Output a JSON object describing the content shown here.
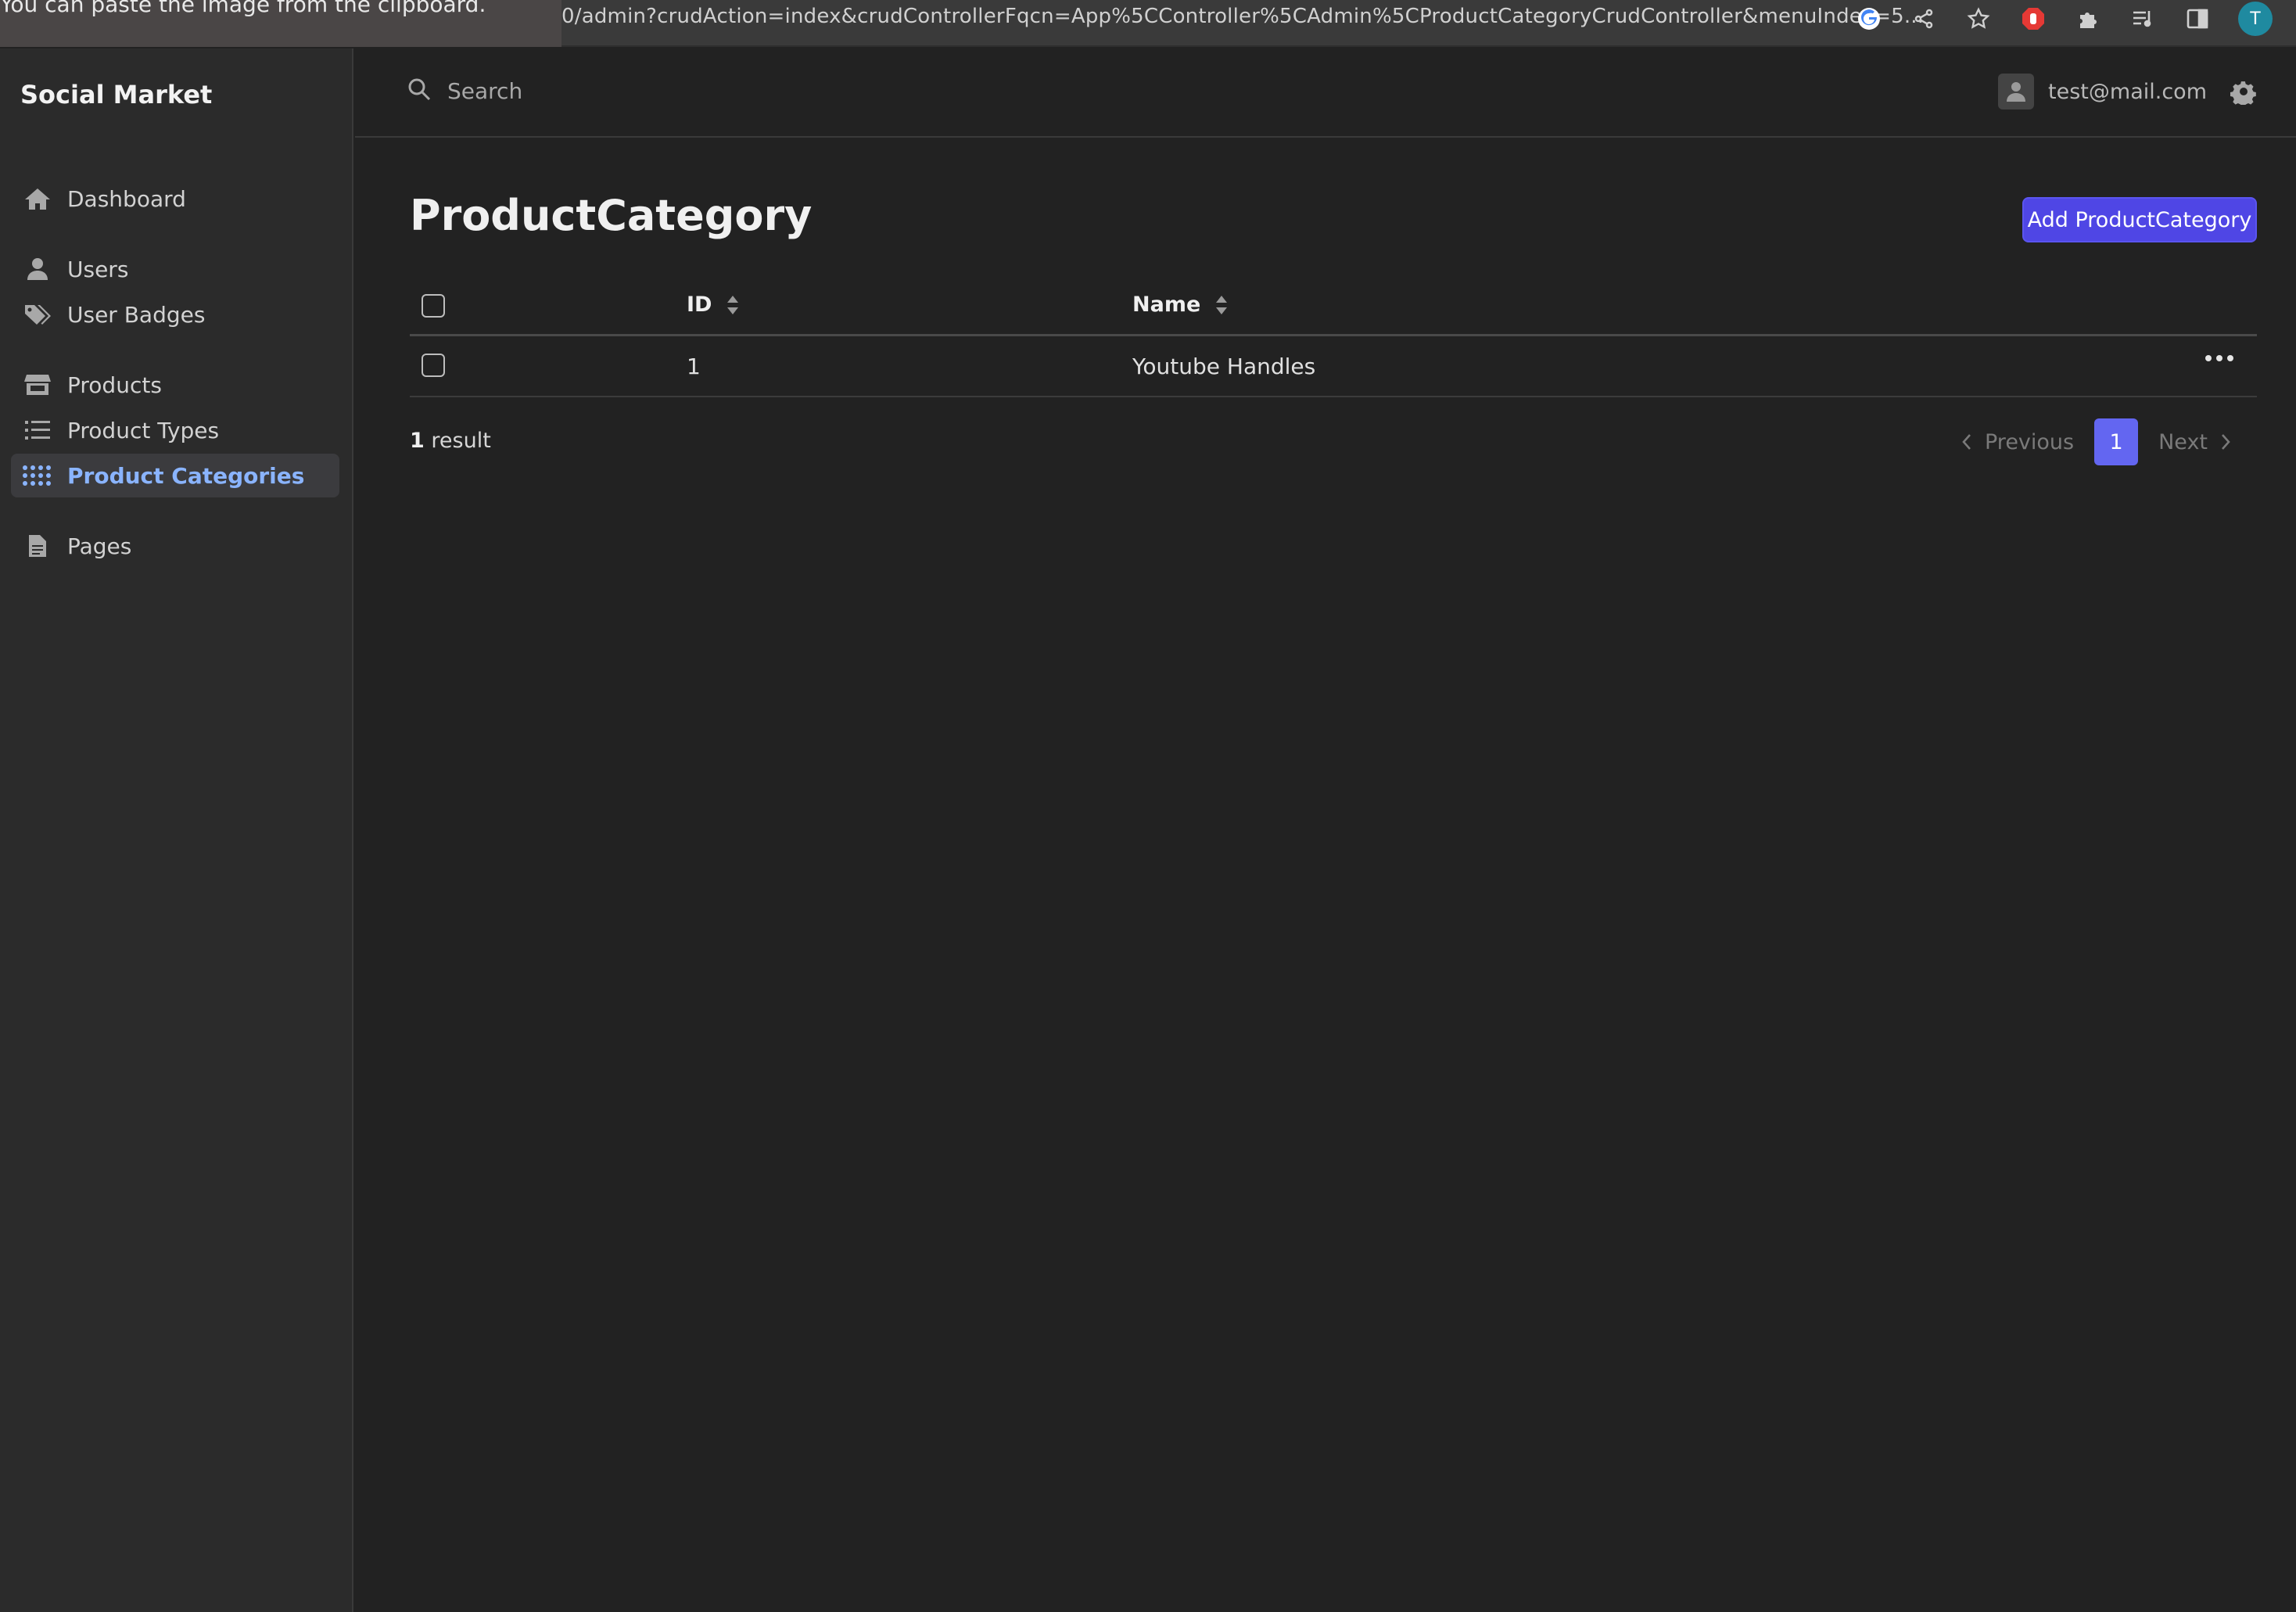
{
  "browser": {
    "toast": "You can paste the image from the clipboard.",
    "url": "0/admin?crudAction=index&crudControllerFqcn=App%5CController%5CAdmin%5CProductCategoryCrudController&menuIndex=5...",
    "profile_initial": "T"
  },
  "sidebar": {
    "brand": "Social Market",
    "items": [
      {
        "label": "Dashboard",
        "icon": "home-icon"
      },
      {
        "label": "Users",
        "icon": "user-icon"
      },
      {
        "label": "User Badges",
        "icon": "tags-icon"
      },
      {
        "label": "Products",
        "icon": "store-icon"
      },
      {
        "label": "Product Types",
        "icon": "list-icon"
      },
      {
        "label": "Product Categories",
        "icon": "grid-icon",
        "active": true
      },
      {
        "label": "Pages",
        "icon": "file-icon"
      }
    ]
  },
  "header": {
    "search_placeholder": "Search",
    "user_email": "test@mail.com"
  },
  "main": {
    "title": "ProductCategory",
    "add_button": "Add ProductCategory",
    "columns": [
      "ID",
      "Name"
    ],
    "rows": [
      {
        "id": "1",
        "name": "Youtube Handles"
      }
    ],
    "result_count": "1",
    "result_label": "result",
    "pagination": {
      "previous": "Previous",
      "current": "1",
      "next": "Next"
    }
  },
  "colors": {
    "accent": "#4f46e5",
    "active_nav_text": "#8ab4ff",
    "background": "#222222",
    "sidebar": "#2b2b2b"
  }
}
